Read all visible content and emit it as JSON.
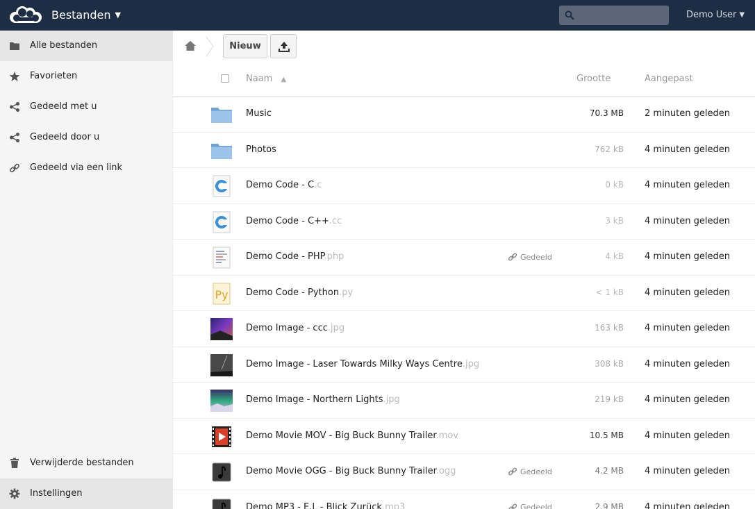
{
  "header": {
    "app_title": "Bestanden",
    "user": "Demo User",
    "search_placeholder": ""
  },
  "sidebar": {
    "items": [
      {
        "label": "Alle bestanden",
        "icon": "folder-icon",
        "active": true
      },
      {
        "label": "Favorieten",
        "icon": "star-icon",
        "active": false
      },
      {
        "label": "Gedeeld met u",
        "icon": "share-icon",
        "active": false
      },
      {
        "label": "Gedeeld door u",
        "icon": "share-icon",
        "active": false
      },
      {
        "label": "Gedeeld via een link",
        "icon": "link-icon",
        "active": false
      }
    ],
    "trash_label": "Verwijderde bestanden",
    "settings_label": "Instellingen"
  },
  "controls": {
    "new_label": "Nieuw"
  },
  "table": {
    "col_name": "Naam",
    "col_size": "Grootte",
    "col_modified": "Aangepast"
  },
  "files": [
    {
      "name": "Music",
      "ext": "",
      "type": "folder",
      "size": "70.3 MB",
      "size_color": "#222222",
      "modified": "2 minuten geleden",
      "shared": false
    },
    {
      "name": "Photos",
      "ext": "",
      "type": "folder",
      "size": "762 kB",
      "size_color": "#aaaaaa",
      "modified": "4 minuten geleden",
      "shared": false
    },
    {
      "name": "Demo Code - C",
      "ext": ".c",
      "type": "c",
      "size": "0 kB",
      "size_color": "#bbbbbb",
      "modified": "4 minuten geleden",
      "shared": false
    },
    {
      "name": "Demo Code - C++",
      "ext": ".cc",
      "type": "c",
      "size": "3 kB",
      "size_color": "#bbbbbb",
      "modified": "4 minuten geleden",
      "shared": false
    },
    {
      "name": "Demo Code - PHP",
      "ext": ".php",
      "type": "php",
      "size": "4 kB",
      "size_color": "#bbbbbb",
      "modified": "4 minuten geleden",
      "shared": true
    },
    {
      "name": "Demo Code - Python",
      "ext": ".py",
      "type": "python",
      "size": "< 1 kB",
      "size_color": "#bbbbbb",
      "modified": "4 minuten geleden",
      "shared": false
    },
    {
      "name": "Demo Image - ccc",
      "ext": ".jpg",
      "type": "image-ccc",
      "size": "163 kB",
      "size_color": "#aaaaaa",
      "modified": "4 minuten geleden",
      "shared": false
    },
    {
      "name": "Demo Image - Laser Towards Milky Ways Centre",
      "ext": ".jpg",
      "type": "image-laser",
      "size": "308 kB",
      "size_color": "#aaaaaa",
      "modified": "4 minuten geleden",
      "shared": false
    },
    {
      "name": "Demo Image - Northern Lights",
      "ext": ".jpg",
      "type": "image-northern",
      "size": "219 kB",
      "size_color": "#aaaaaa",
      "modified": "4 minuten geleden",
      "shared": false
    },
    {
      "name": "Demo Movie MOV - Big Buck Bunny Trailer",
      "ext": ".mov",
      "type": "movie",
      "size": "10.5 MB",
      "size_color": "#333333",
      "modified": "4 minuten geleden",
      "shared": false
    },
    {
      "name": "Demo Movie OGG - Big Buck Bunny Trailer",
      "ext": ".ogg",
      "type": "audio",
      "size": "4.2 MB",
      "size_color": "#777777",
      "modified": "4 minuten geleden",
      "shared": true
    },
    {
      "name": "Demo MP3 - E.L - Blick Zurück",
      "ext": ".mp3",
      "type": "audio",
      "size": "2.9 MB",
      "size_color": "#777777",
      "modified": "4 minuten geleden",
      "shared": true
    }
  ],
  "shared_label": "Gedeeld"
}
